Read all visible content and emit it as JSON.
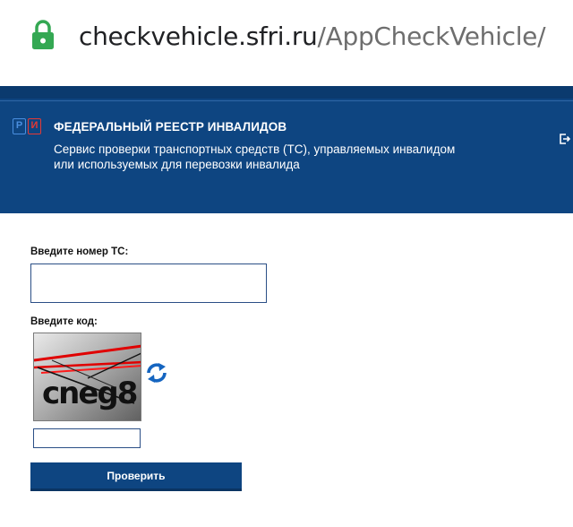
{
  "browser": {
    "url_host": "checkvehicle.sfri.ru",
    "url_path": "/AppCheckVehicle/"
  },
  "header": {
    "logo_left": "Р",
    "logo_right": "И",
    "title": "ФЕДЕРАЛЬНЫЙ РЕЕСТР ИНВАЛИДОВ",
    "subtitle_line1": "Сервис проверки транспортных средств (ТС), управляемых инвалидом",
    "subtitle_line2": "или используемых для перевозки инвалида"
  },
  "form": {
    "vehicle_label": "Введите номер ТС:",
    "vehicle_value": "",
    "code_label": "Введите код:",
    "captcha_text": "cneg8",
    "code_value": "",
    "submit_label": "Проверить"
  },
  "colors": {
    "header_bg": "#0e4581",
    "accent_red": "#e53935",
    "lock_green": "#34a853"
  }
}
